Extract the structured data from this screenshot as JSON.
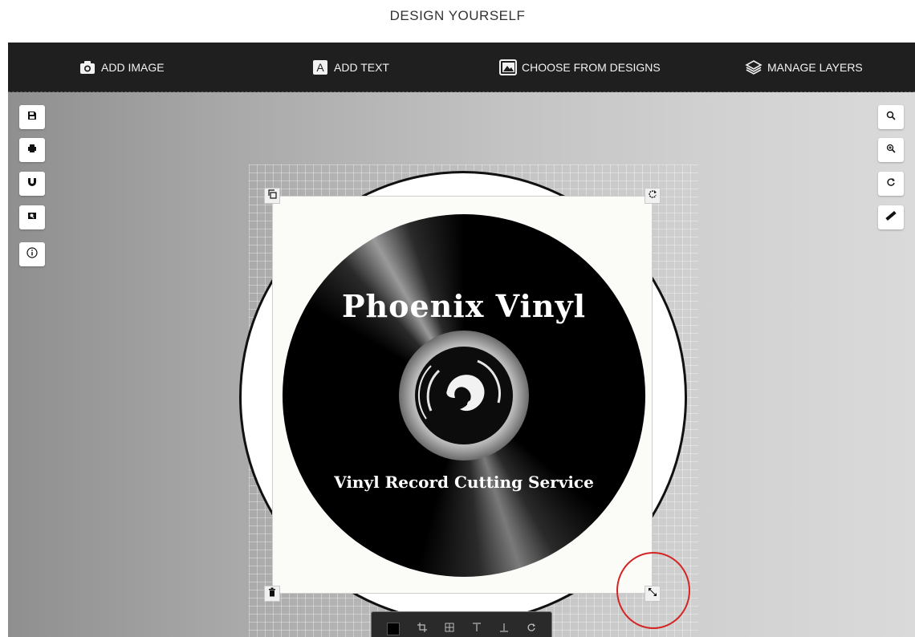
{
  "page": {
    "heading": "DESIGN YOURSELF"
  },
  "toolbar": {
    "add_image": {
      "label": "ADD IMAGE",
      "icon": "camera-icon"
    },
    "add_text": {
      "label": "ADD TEXT",
      "icon": "text-a-icon"
    },
    "choose_designs": {
      "label": "CHOOSE FROM DESIGNS",
      "icon": "image-gallery-icon"
    },
    "manage_layers": {
      "label": "MANAGE LAYERS",
      "icon": "layers-icon"
    }
  },
  "left_tools": [
    "save-icon",
    "print-icon",
    "magnet-icon",
    "preview-icon",
    "info-icon"
  ],
  "right_tools": [
    "search-icon",
    "zoom-in-icon",
    "refresh-icon",
    "ruler-icon"
  ],
  "design": {
    "title": "Phoenix Vinyl",
    "subtitle": "Vinyl Record Cutting Service"
  },
  "handles": [
    "duplicate-icon",
    "rotate-icon",
    "delete-icon",
    "resize-icon"
  ],
  "bottom_tools": {
    "color": "#000000",
    "icons": [
      "crop-icon",
      "center-icon",
      "align-top-icon",
      "align-bottom-icon",
      "flip-icon"
    ]
  },
  "colors": {
    "toolbar_bg": "#1f1f1f",
    "highlight": "#d42424"
  }
}
